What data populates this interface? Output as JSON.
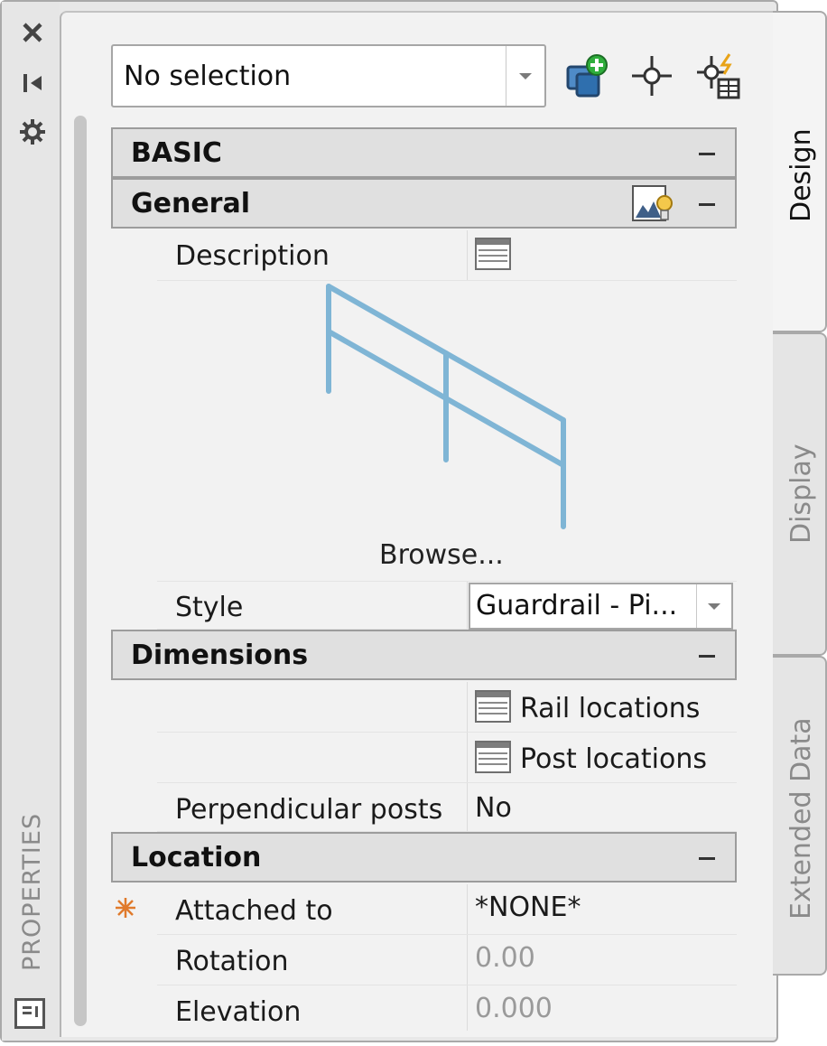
{
  "palette": {
    "vertical_title": "PROPERTIES"
  },
  "quick_select": {
    "selection": "No selection"
  },
  "categories": {
    "basic": "BASIC",
    "general": "General",
    "dimensions": "Dimensions",
    "location": "Location"
  },
  "general": {
    "description_label": "Description",
    "browse_label": "Browse...",
    "style_label": "Style",
    "style_value": "Guardrail - Pi..."
  },
  "dimensions": {
    "rail_locations": "Rail locations",
    "post_locations": "Post locations",
    "perpendicular_posts_label": "Perpendicular posts",
    "perpendicular_posts_value": "No"
  },
  "location": {
    "attached_to_label": "Attached to",
    "attached_to_value": "*NONE*",
    "rotation_label": "Rotation",
    "rotation_value": "0.00",
    "elevation_label": "Elevation",
    "elevation_value": "0.000"
  },
  "tabs": {
    "design": "Design",
    "display": "Display",
    "extended_data": "Extended Data"
  },
  "icons": {
    "close": "close-icon",
    "auto_hide": "auto-hide-icon",
    "settings": "gear-icon",
    "select_objects": "select-objects-icon",
    "pick_add": "crosshair-icon",
    "quick_select": "quick-select-icon",
    "style_thumbnail": "style-thumbnail-icon",
    "required_marker": "asterisk-icon"
  },
  "colors": {
    "preview_rail": "#7fb5d5",
    "required_marker": "#e07a2c"
  }
}
